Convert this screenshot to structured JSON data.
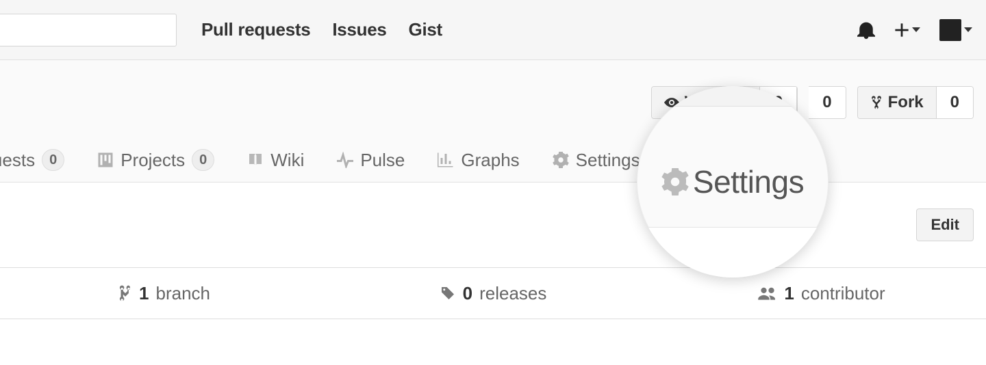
{
  "header": {
    "search_placeholder": "",
    "nav": {
      "pull_requests": "Pull requests",
      "issues": "Issues",
      "gist": "Gist"
    }
  },
  "repo_actions": {
    "watch": {
      "label": "Watch",
      "count": "0"
    },
    "star": {
      "count": "0"
    },
    "fork": {
      "label": "Fork",
      "count": "0"
    }
  },
  "tabs": {
    "pull_requests": {
      "label": "equests",
      "count": "0"
    },
    "projects": {
      "label": "Projects",
      "count": "0"
    },
    "wiki": {
      "label": "Wiki"
    },
    "pulse": {
      "label": "Pulse"
    },
    "graphs": {
      "label": "Graphs"
    },
    "settings": {
      "label": "Settings"
    }
  },
  "desc": {
    "edit": "Edit"
  },
  "stats": {
    "branches": {
      "count": "1",
      "label": "branch"
    },
    "releases": {
      "count": "0",
      "label": "releases"
    },
    "contributors": {
      "count": "1",
      "label": "contributor"
    }
  },
  "magnifier": {
    "label": "Settings"
  }
}
